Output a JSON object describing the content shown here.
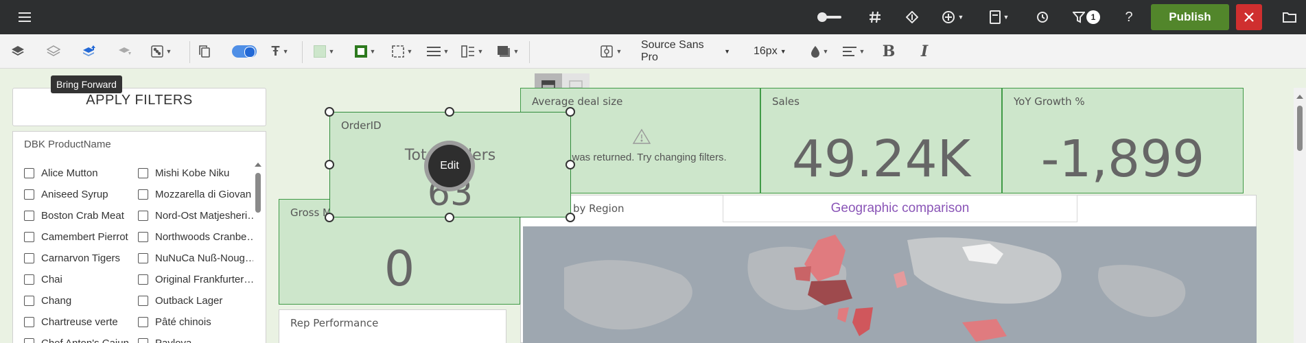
{
  "topbar": {
    "menu_icon": "hamburger-menu-icon",
    "filter_count": "1",
    "publish_label": "Publish",
    "close_icon": "close-icon",
    "colors": {
      "bar": "#2d2f30",
      "publish": "#52862b",
      "close": "#cf2f2f"
    }
  },
  "toolbar": {
    "font_family": "Source Sans Pro",
    "font_size": "16px",
    "bold_label": "B",
    "italic_label": "I"
  },
  "tooltip": {
    "text": "Bring Forward"
  },
  "filters": {
    "apply_label": "APPLY FILTERS"
  },
  "listbox": {
    "title": "DBK ProductName",
    "col1": [
      "Alice Mutton",
      "Aniseed Syrup",
      "Boston Crab Meat",
      "Camembert Pierrot",
      "Carnarvon Tigers",
      "Chai",
      "Chang",
      "Chartreuse verte",
      "Chef Anton's Cajun"
    ],
    "col2": [
      "Mishi Kobe Niku",
      "Mozzarella di Giovan",
      "Nord-Ost Matjesheri…",
      "Northwoods Cranbe…",
      "NuNuCa Nuß-Noug…",
      "Original Frankfurter…",
      "Outback Lager",
      "Pâté chinois",
      "Pavlova"
    ]
  },
  "cards": {
    "orderid": {
      "title": "OrderID",
      "subtitle": "Total Orders",
      "value": "63"
    },
    "gross": {
      "title": "Gross M",
      "value": "0"
    },
    "avg_deal": {
      "title": "Average deal size",
      "message": "a was returned. Try changing filters."
    },
    "sales": {
      "title": "Sales",
      "value": "49.24K"
    },
    "yoy": {
      "title": "YoY Growth %",
      "value": "-1,899"
    },
    "rep": {
      "title": "Rep Performance"
    },
    "region": {
      "title": "by Region"
    },
    "geo": {
      "title": "Geographic comparison"
    }
  },
  "edit_label": "Edit"
}
